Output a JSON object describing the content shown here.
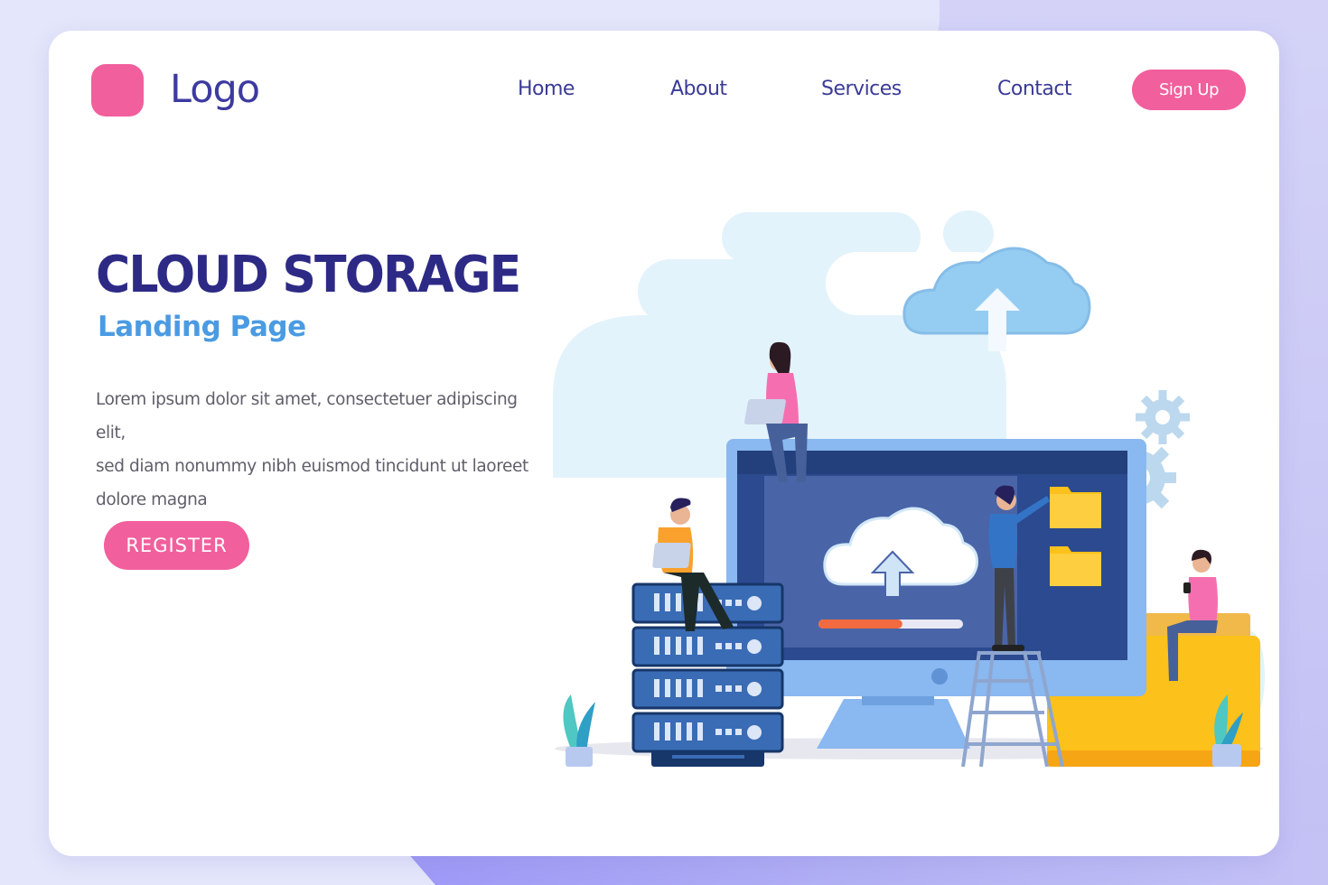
{
  "brand": {
    "logo_text": "Logo",
    "colors": {
      "accent_pink": "#f25f9d",
      "title_navy": "#2d2a86",
      "nav_text": "#3b3b96",
      "subtitle_blue": "#4a9be2",
      "body_text": "#5f5f6a",
      "page_background": "#e4e6fb",
      "card_background": "#ffffff"
    }
  },
  "nav": {
    "items": [
      {
        "label": "Home"
      },
      {
        "label": "About"
      },
      {
        "label": "Services"
      },
      {
        "label": "Contact"
      }
    ],
    "signup_label": "Sign Up"
  },
  "hero": {
    "title": "CLOUD STORAGE",
    "subtitle": "Landing Page",
    "description_lines": [
      "Lorem ipsum dolor sit amet, consectetuer adipiscing elit,",
      "sed diam nonummy nibh euismod tincidunt ut laoreet",
      "dolore magna"
    ],
    "register_label": "REGISTER"
  },
  "illustration": {
    "description": "Cloud storage illustration: monitor with upload cloud, server rack, folders, gears and people",
    "icons": [
      "cloud-upload-icon",
      "server-rack-icon",
      "folder-icon",
      "gear-icon",
      "monitor-icon",
      "ladder-icon",
      "plant-icon",
      "laptop-icon"
    ],
    "upload_progress_percent": 58,
    "colors": {
      "monitor_frame": "#8ab8f0",
      "screen_dark": "#2b4a8f",
      "screen_panel": "#4a64a8",
      "progress_fill": "#f26a3f",
      "progress_track": "#e8e9f5",
      "folder_yellow": "#fcc11a",
      "server_blue": "#3a6cb5",
      "cloud_light": "#e3f3fb",
      "gear_blue": "#bcd8ee"
    }
  }
}
